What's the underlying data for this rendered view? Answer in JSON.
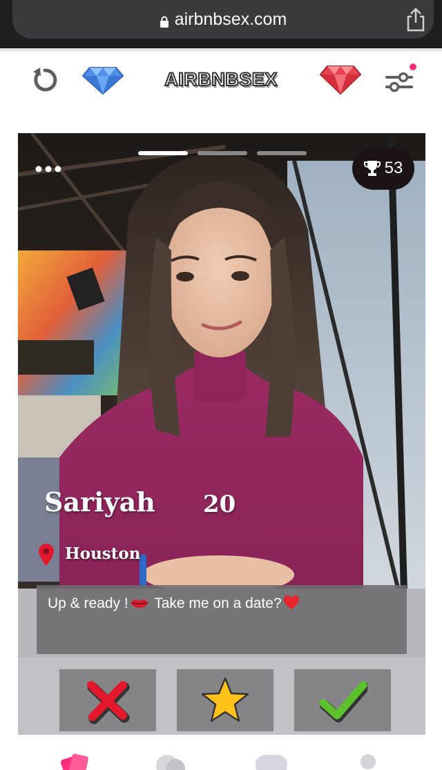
{
  "browser": {
    "url": "airbnbsex.com",
    "icons": {
      "lock": "lock-icon",
      "share": "share-icon"
    }
  },
  "header": {
    "brand": "AIRBNBSEX",
    "icons": [
      "undo-icon",
      "blue-diamond-icon",
      "red-diamond-icon",
      "filter-sliders-icon"
    ],
    "notification_dot": true
  },
  "card": {
    "photo_pages": 3,
    "current_photo": 1,
    "score": "53",
    "name": "Sariyah",
    "age": "20",
    "location": "Houston",
    "bio": {
      "part1": "Up & ready !",
      "part2": " Take me on a date?"
    }
  },
  "actions": [
    {
      "name": "reject-button",
      "icon": "red-x-icon"
    },
    {
      "name": "super-like-button",
      "icon": "star-icon"
    },
    {
      "name": "like-button",
      "icon": "green-check-icon"
    }
  ],
  "bottom_nav": {
    "items": [
      "swipe-tab-icon",
      "chat-tab-icon",
      "messages-tab-icon",
      "profile-tab-icon"
    ]
  },
  "colors": {
    "accent_pink": "#ff2d7a",
    "reject_red": "#e3182d",
    "like_green": "#5cc22b",
    "star_gold": "#ffc21a",
    "gem_blue": "#4f8fe6",
    "gem_red": "#e8424f"
  }
}
